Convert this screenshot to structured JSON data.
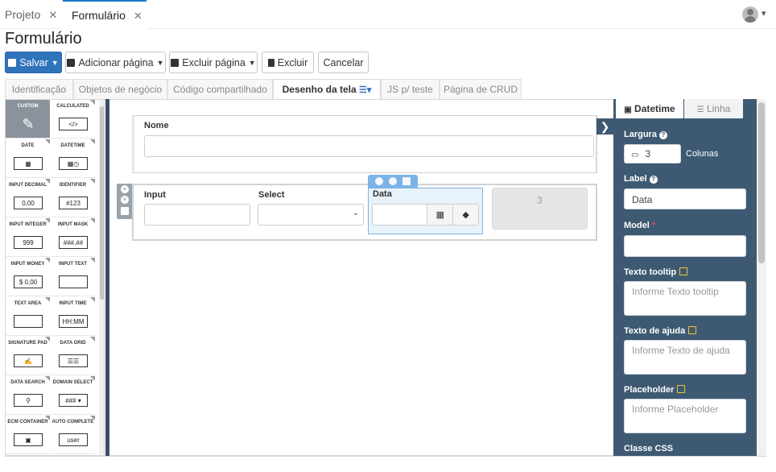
{
  "top_tabs": [
    {
      "label": "Projeto",
      "close": "✕"
    },
    {
      "label": "Formulário",
      "close": "✕"
    }
  ],
  "page_title": "Formulário",
  "toolbar": {
    "save_label": "Salvar",
    "add_page_label": "Adicionar página",
    "delete_page_label": "Excluir página",
    "delete_label": "Excluir",
    "cancel_label": "Cancelar"
  },
  "sub_tabs": [
    {
      "label": "Identificação"
    },
    {
      "label": "Objetos de negócio"
    },
    {
      "label": "Código compartilhado"
    },
    {
      "label": "Desenho da tela"
    },
    {
      "label": "JS p/ teste"
    },
    {
      "label": "Página de CRUD"
    }
  ],
  "palette": [
    {
      "label": "CUSTOM",
      "icon": "edit-icon",
      "glyph": "✎"
    },
    {
      "label": "CALCULATED",
      "icon": "code-icon",
      "glyph": "</>"
    },
    {
      "label": "DATE",
      "icon": "calendar-icon",
      "glyph": "▦"
    },
    {
      "label": "DATETIME",
      "icon": "calendar-clock-icon",
      "glyph": "▦◷"
    },
    {
      "label": "INPUT DECIMAL",
      "icon": "decimal-icon",
      "glyph": "0,00"
    },
    {
      "label": "IDENTIFIER",
      "icon": "identifier-icon",
      "glyph": "#123"
    },
    {
      "label": "INPUT INTEGER",
      "icon": "integer-icon",
      "glyph": "999"
    },
    {
      "label": "INPUT MASK",
      "icon": "mask-icon",
      "glyph": "###,##"
    },
    {
      "label": "INPUT MONEY",
      "icon": "money-icon",
      "glyph": "$ 0,00"
    },
    {
      "label": "INPUT TEXT",
      "icon": "text-input-icon",
      "glyph": ""
    },
    {
      "label": "TEXT AREA",
      "icon": "textarea-icon",
      "glyph": ""
    },
    {
      "label": "INPUT TIME",
      "icon": "time-icon",
      "glyph": "HH:MM"
    },
    {
      "label": "SIGNATURE PAD",
      "icon": "signature-icon",
      "glyph": "✍"
    },
    {
      "label": "DATA GRID",
      "icon": "grid-icon",
      "glyph": "☰☰"
    },
    {
      "label": "DATA SEARCH",
      "icon": "search-icon",
      "glyph": "⚲"
    },
    {
      "label": "DOMAIN SELECT",
      "icon": "domain-select-icon",
      "glyph": "### ▾"
    },
    {
      "label": "ECM CONTAINER",
      "icon": "ecm-icon",
      "glyph": "▣"
    },
    {
      "label": "AUTO COMPLETE",
      "icon": "autocomplete-icon",
      "glyph": "user"
    }
  ],
  "canvas": {
    "row1": {
      "label": "Nome"
    },
    "row2": {
      "input_label": "Input",
      "select_label": "Select",
      "data_label": "Data",
      "placeholder_number": "3"
    }
  },
  "right_panel": {
    "tab_datetime": "Datetime",
    "tab_line": "Linha",
    "width_label": "Largura",
    "width_value": "3",
    "width_unit": "Colunas",
    "label_label": "Label",
    "label_value": "Data",
    "model_label": "Model",
    "model_required": "*",
    "tooltip_label": "Texto tooltip",
    "tooltip_placeholder": "Informe Texto tooltip",
    "help_label": "Texto de ajuda",
    "help_placeholder": "Informe Texto de ajuda",
    "placeholder_label": "Placeholder",
    "placeholder_placeholder": "Informe Placeholder",
    "css_label": "Classe CSS"
  },
  "colors": {
    "primary": "#2f73bc",
    "panel": "#3e5a72",
    "selection": "#7cb3e8",
    "edit_icon": "#f0c43a"
  }
}
